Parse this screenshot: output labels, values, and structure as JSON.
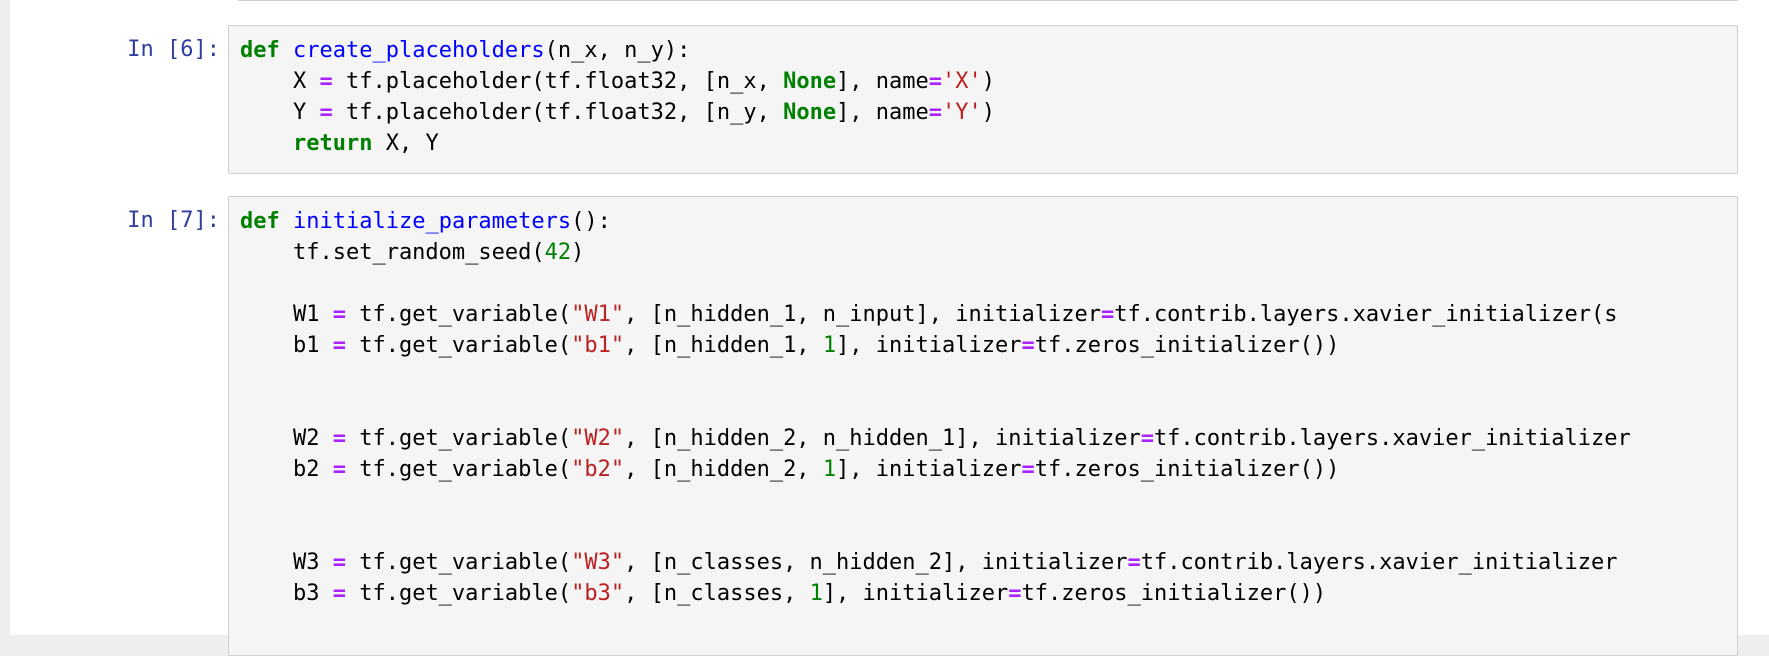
{
  "colors": {
    "keyword": "#008000",
    "function_name": "#0000ff",
    "operator": "#aa22ff",
    "string": "#ba2121",
    "number": "#008000",
    "prompt": "#303f9f",
    "cell_background": "#f5f5f5",
    "cell_border": "#cfcfcf"
  },
  "cells": [
    {
      "prompt": "In [6]:",
      "lines": [
        [
          {
            "t": "kw",
            "v": "def"
          },
          {
            "t": "p",
            "v": " "
          },
          {
            "t": "fn",
            "v": "create_placeholders"
          },
          {
            "t": "p",
            "v": "(n_x, n_y):"
          }
        ],
        [
          {
            "t": "p",
            "v": "    X "
          },
          {
            "t": "op",
            "v": "="
          },
          {
            "t": "p",
            "v": " tf.placeholder(tf.float32, [n_x, "
          },
          {
            "t": "kw",
            "v": "None"
          },
          {
            "t": "p",
            "v": "], name"
          },
          {
            "t": "op",
            "v": "="
          },
          {
            "t": "str",
            "v": "'X'"
          },
          {
            "t": "p",
            "v": ")"
          }
        ],
        [
          {
            "t": "p",
            "v": "    Y "
          },
          {
            "t": "op",
            "v": "="
          },
          {
            "t": "p",
            "v": " tf.placeholder(tf.float32, [n_y, "
          },
          {
            "t": "kw",
            "v": "None"
          },
          {
            "t": "p",
            "v": "], name"
          },
          {
            "t": "op",
            "v": "="
          },
          {
            "t": "str",
            "v": "'Y'"
          },
          {
            "t": "p",
            "v": ")"
          }
        ],
        [
          {
            "t": "p",
            "v": "    "
          },
          {
            "t": "kw",
            "v": "return"
          },
          {
            "t": "p",
            "v": " X, Y"
          }
        ]
      ]
    },
    {
      "prompt": "In [7]:",
      "lines": [
        [
          {
            "t": "kw",
            "v": "def"
          },
          {
            "t": "p",
            "v": " "
          },
          {
            "t": "fn",
            "v": "initialize_parameters"
          },
          {
            "t": "p",
            "v": "():"
          }
        ],
        [
          {
            "t": "p",
            "v": "    tf.set_random_seed("
          },
          {
            "t": "num",
            "v": "42"
          },
          {
            "t": "p",
            "v": ")"
          }
        ],
        [],
        [
          {
            "t": "p",
            "v": "    W1 "
          },
          {
            "t": "op",
            "v": "="
          },
          {
            "t": "p",
            "v": " tf.get_variable("
          },
          {
            "t": "str",
            "v": "\"W1\""
          },
          {
            "t": "p",
            "v": ", [n_hidden_1, n_input], initializer"
          },
          {
            "t": "op",
            "v": "="
          },
          {
            "t": "p",
            "v": "tf.contrib.layers.xavier_initializer(s"
          }
        ],
        [
          {
            "t": "p",
            "v": "    b1 "
          },
          {
            "t": "op",
            "v": "="
          },
          {
            "t": "p",
            "v": " tf.get_variable("
          },
          {
            "t": "str",
            "v": "\"b1\""
          },
          {
            "t": "p",
            "v": ", [n_hidden_1, "
          },
          {
            "t": "num",
            "v": "1"
          },
          {
            "t": "p",
            "v": "], initializer"
          },
          {
            "t": "op",
            "v": "="
          },
          {
            "t": "p",
            "v": "tf.zeros_initializer())"
          }
        ],
        [],
        [],
        [
          {
            "t": "p",
            "v": "    W2 "
          },
          {
            "t": "op",
            "v": "="
          },
          {
            "t": "p",
            "v": " tf.get_variable("
          },
          {
            "t": "str",
            "v": "\"W2\""
          },
          {
            "t": "p",
            "v": ", [n_hidden_2, n_hidden_1], initializer"
          },
          {
            "t": "op",
            "v": "="
          },
          {
            "t": "p",
            "v": "tf.contrib.layers.xavier_initializer"
          }
        ],
        [
          {
            "t": "p",
            "v": "    b2 "
          },
          {
            "t": "op",
            "v": "="
          },
          {
            "t": "p",
            "v": " tf.get_variable("
          },
          {
            "t": "str",
            "v": "\"b2\""
          },
          {
            "t": "p",
            "v": ", [n_hidden_2, "
          },
          {
            "t": "num",
            "v": "1"
          },
          {
            "t": "p",
            "v": "], initializer"
          },
          {
            "t": "op",
            "v": "="
          },
          {
            "t": "p",
            "v": "tf.zeros_initializer())"
          }
        ],
        [],
        [],
        [
          {
            "t": "p",
            "v": "    W3 "
          },
          {
            "t": "op",
            "v": "="
          },
          {
            "t": "p",
            "v": " tf.get_variable("
          },
          {
            "t": "str",
            "v": "\"W3\""
          },
          {
            "t": "p",
            "v": ", [n_classes, n_hidden_2], initializer"
          },
          {
            "t": "op",
            "v": "="
          },
          {
            "t": "p",
            "v": "tf.contrib.layers.xavier_initializer"
          }
        ],
        [
          {
            "t": "p",
            "v": "    b3 "
          },
          {
            "t": "op",
            "v": "="
          },
          {
            "t": "p",
            "v": " tf.get_variable("
          },
          {
            "t": "str",
            "v": "\"b3\""
          },
          {
            "t": "p",
            "v": ", [n_classes, "
          },
          {
            "t": "num",
            "v": "1"
          },
          {
            "t": "p",
            "v": "], initializer"
          },
          {
            "t": "op",
            "v": "="
          },
          {
            "t": "p",
            "v": "tf.zeros_initializer())"
          }
        ]
      ]
    }
  ]
}
